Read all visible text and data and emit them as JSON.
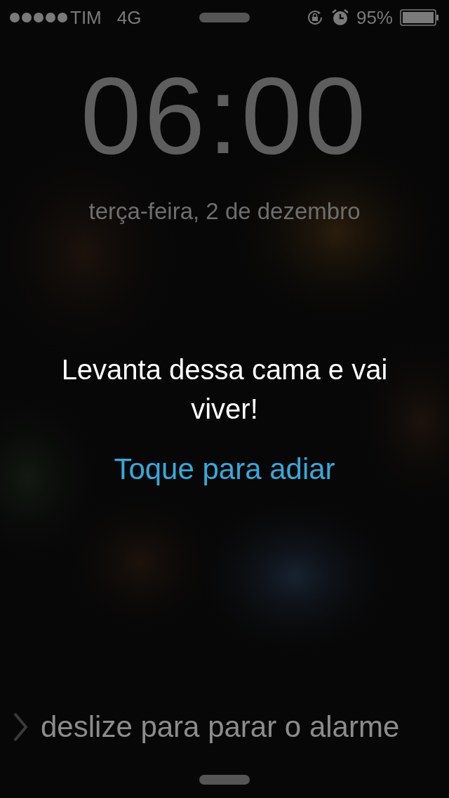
{
  "status_bar": {
    "carrier": "TIM",
    "network": "4G",
    "battery_percent": "95%"
  },
  "lock": {
    "time": "06:00",
    "date": "terça-feira, 2 de dezembro"
  },
  "alarm": {
    "message": "Levanta dessa cama e vai viver!",
    "snooze": "Toque para adiar"
  },
  "slider": {
    "label": "deslize para parar o alarme"
  }
}
